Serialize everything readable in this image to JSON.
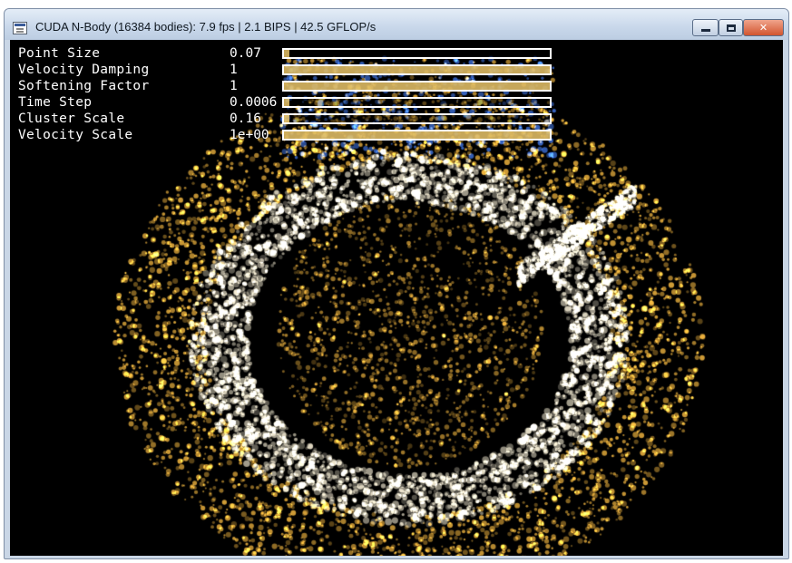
{
  "window": {
    "title": "CUDA N-Body (16384 bodies): 7.9 fps | 2.1 BIPS | 42.5 GFLOP/s",
    "buttons": {
      "minimize": "minimize",
      "maximize": "maximize",
      "close": "✕"
    }
  },
  "params": [
    {
      "label": "Point Size",
      "value": "0.07",
      "level": 0.02
    },
    {
      "label": "Velocity Damping",
      "value": "1",
      "level": 1.0
    },
    {
      "label": "Softening Factor",
      "value": "1",
      "level": 1.0
    },
    {
      "label": "Time Step",
      "value": "0.0006",
      "level": 0.02
    },
    {
      "label": "Cluster Scale",
      "value": "0.16",
      "level": 0.02
    },
    {
      "label": "Velocity Scale",
      "value": "1e+00",
      "level": 1.0
    }
  ],
  "colors": {
    "particles": "#f5b840",
    "particles_bright": "#fff6dc",
    "particles_blue": "#3d6fd6",
    "background": "#000000",
    "slider_fill": "#e9c46a"
  }
}
